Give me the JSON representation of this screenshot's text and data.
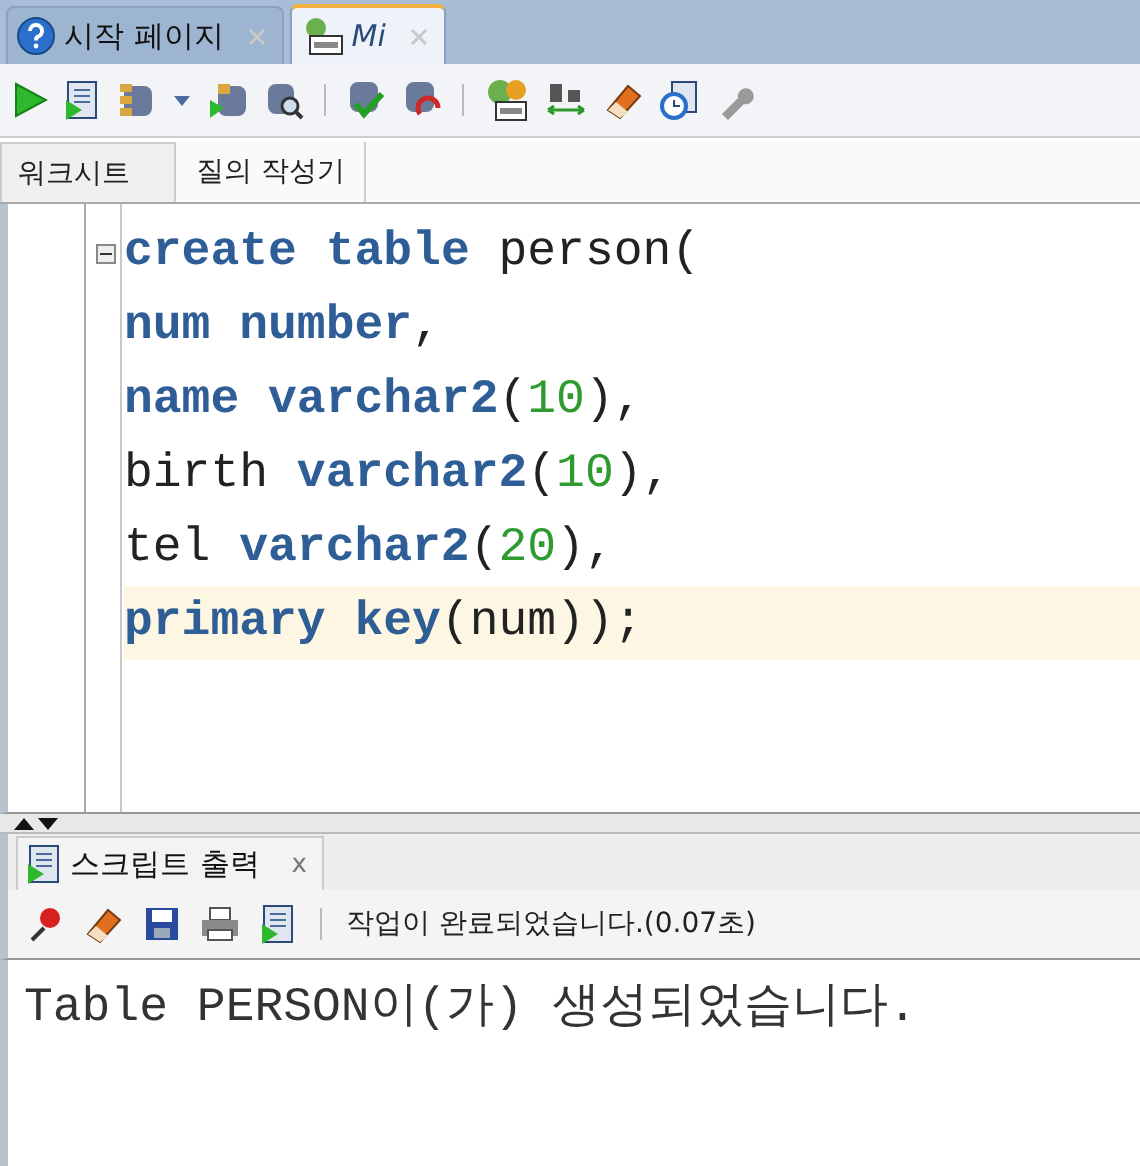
{
  "doc_tabs": [
    {
      "label": "시작 페이지",
      "kind": "help",
      "selected": false,
      "closable": true
    },
    {
      "label": "Mi",
      "kind": "sql",
      "selected": true,
      "closable": true
    }
  ],
  "sub_tabs": [
    {
      "label": "워크시트",
      "selected": true
    },
    {
      "label": "질의 작성기",
      "selected": false
    }
  ],
  "code_lines": [
    {
      "current": false,
      "foldable": true,
      "tokens": [
        {
          "text": "create ",
          "kind": "keyword"
        },
        {
          "text": "table ",
          "kind": "keyword"
        },
        {
          "text": "person(",
          "kind": "plain"
        }
      ]
    },
    {
      "current": false,
      "foldable": false,
      "tokens": [
        {
          "text": "num ",
          "kind": "keyword"
        },
        {
          "text": "number",
          "kind": "keyword"
        },
        {
          "text": ",",
          "kind": "plain"
        }
      ]
    },
    {
      "current": false,
      "foldable": false,
      "tokens": [
        {
          "text": "name ",
          "kind": "keyword"
        },
        {
          "text": "varchar2",
          "kind": "keyword"
        },
        {
          "text": "(",
          "kind": "plain"
        },
        {
          "text": "10",
          "kind": "number"
        },
        {
          "text": "),",
          "kind": "plain"
        }
      ]
    },
    {
      "current": false,
      "foldable": false,
      "tokens": [
        {
          "text": "birth ",
          "kind": "plain"
        },
        {
          "text": "varchar2",
          "kind": "keyword"
        },
        {
          "text": "(",
          "kind": "plain"
        },
        {
          "text": "10",
          "kind": "number"
        },
        {
          "text": "),",
          "kind": "plain"
        }
      ]
    },
    {
      "current": false,
      "foldable": false,
      "tokens": [
        {
          "text": "tel ",
          "kind": "plain"
        },
        {
          "text": "varchar2",
          "kind": "keyword"
        },
        {
          "text": "(",
          "kind": "plain"
        },
        {
          "text": "20",
          "kind": "number"
        },
        {
          "text": "),",
          "kind": "plain"
        }
      ]
    },
    {
      "current": true,
      "foldable": false,
      "tokens": [
        {
          "text": "primary ",
          "kind": "keyword"
        },
        {
          "text": "key",
          "kind": "keyword"
        },
        {
          "text": "(num));",
          "kind": "plain"
        }
      ]
    }
  ],
  "output_panel": {
    "tab": {
      "label": "스크립트 출력",
      "close": "x"
    },
    "status": "작업이 완료되었습니다.(0.07초)",
    "lines": [
      "Table PERSON이(가) 생성되었습니다."
    ]
  }
}
